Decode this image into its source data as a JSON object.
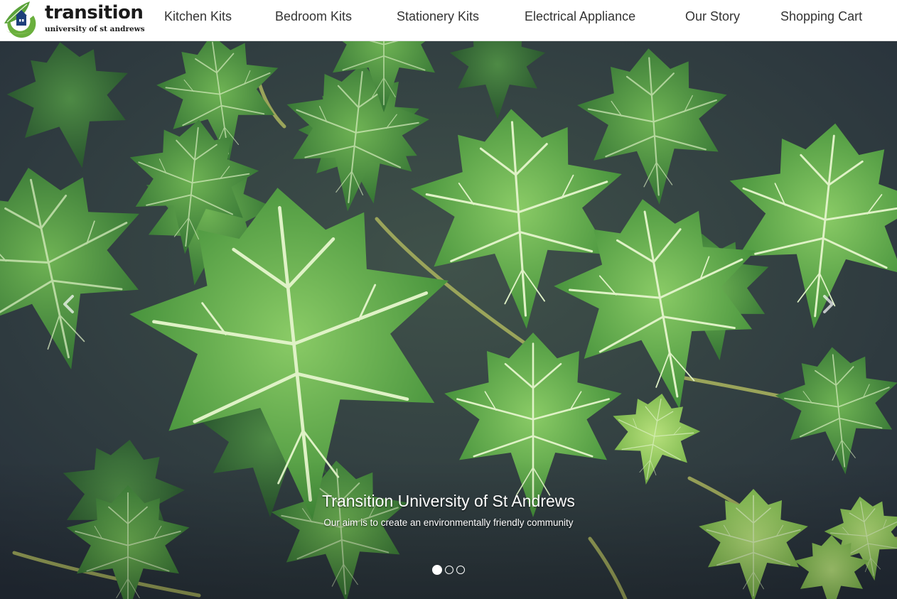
{
  "brand": {
    "name": "transition",
    "subtitle": "university of st andrews"
  },
  "nav": {
    "items": [
      {
        "label": "Kitchen Kits"
      },
      {
        "label": "Bedroom Kits"
      },
      {
        "label": "Stationery Kits"
      },
      {
        "label": "Electrical Appliance"
      },
      {
        "label": "Our Story"
      },
      {
        "label": "Shopping Cart"
      }
    ]
  },
  "carousel": {
    "caption_title": "Transition University of St Andrews",
    "caption_text": "Our aim is to create an environmentally friendly community",
    "slide_count": 3,
    "active_slide": 1,
    "prev_icon": "chevron-left-icon",
    "next_icon": "chevron-right-icon"
  },
  "colors": {
    "logo_green": "#6aaf3d",
    "logo_blue": "#1d3f7a",
    "leaf_green": "#4f9a3c",
    "background_dark": "#36433f",
    "nav_text": "#333333"
  }
}
